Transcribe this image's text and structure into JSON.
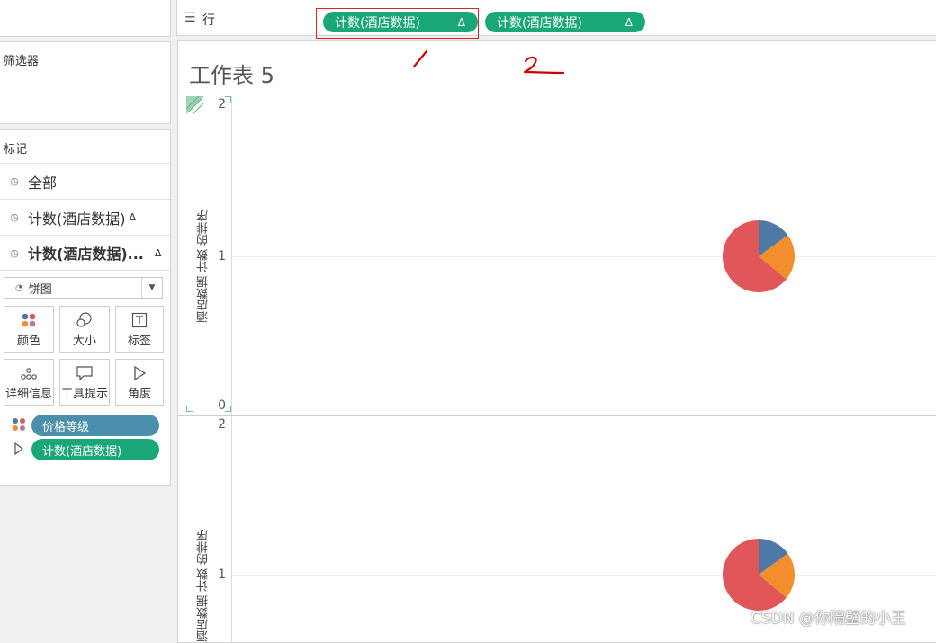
{
  "shelf": {
    "label": "行",
    "pills": [
      {
        "label": "计数(酒店数据)",
        "symbol": "Δ"
      },
      {
        "label": "计数(酒店数据)",
        "symbol": "Δ"
      }
    ]
  },
  "annotations": {
    "one": "1",
    "two": "2"
  },
  "filters": {
    "title": "筛选器"
  },
  "marks": {
    "title": "标记",
    "cards": [
      {
        "label": "全部"
      },
      {
        "label": "计数(酒店数据)",
        "symbol": "Δ"
      },
      {
        "label": "计数(酒店数据)...",
        "symbol": "Δ"
      }
    ],
    "mark_type": "饼图",
    "buttons": [
      "颜色",
      "大小",
      "标签",
      "详细信息",
      "工具提示",
      "角度"
    ],
    "fields": [
      {
        "label": "价格等级",
        "role": "color",
        "color": "#4a90ad"
      },
      {
        "label": "计数(酒店数据)",
        "role": "angle",
        "color": "#1aa777"
      }
    ]
  },
  "worksheet": {
    "title": "工作表 5"
  },
  "chart_data": [
    {
      "type": "pie",
      "ylabel": "酒店数据 计数 的排序",
      "yticks": [
        "2",
        "1",
        "0"
      ],
      "ylim": [
        0,
        2
      ],
      "pie_y": 1,
      "slices": [
        {
          "color": "#4e79a7",
          "fraction": 0.15
        },
        {
          "color": "#f28e2b",
          "fraction": 0.21
        },
        {
          "color": "#e15759",
          "fraction": 0.64
        }
      ]
    },
    {
      "type": "pie",
      "ylabel": "酒店数据 计数 的排序",
      "yticks": [
        "2",
        "1"
      ],
      "ylim": [
        0,
        2
      ],
      "pie_y": 1,
      "slices": [
        {
          "color": "#4e79a7",
          "fraction": 0.15
        },
        {
          "color": "#f28e2b",
          "fraction": 0.21
        },
        {
          "color": "#e15759",
          "fraction": 0.64
        }
      ]
    }
  ],
  "watermark": "CSDN @你隔壁的小王"
}
